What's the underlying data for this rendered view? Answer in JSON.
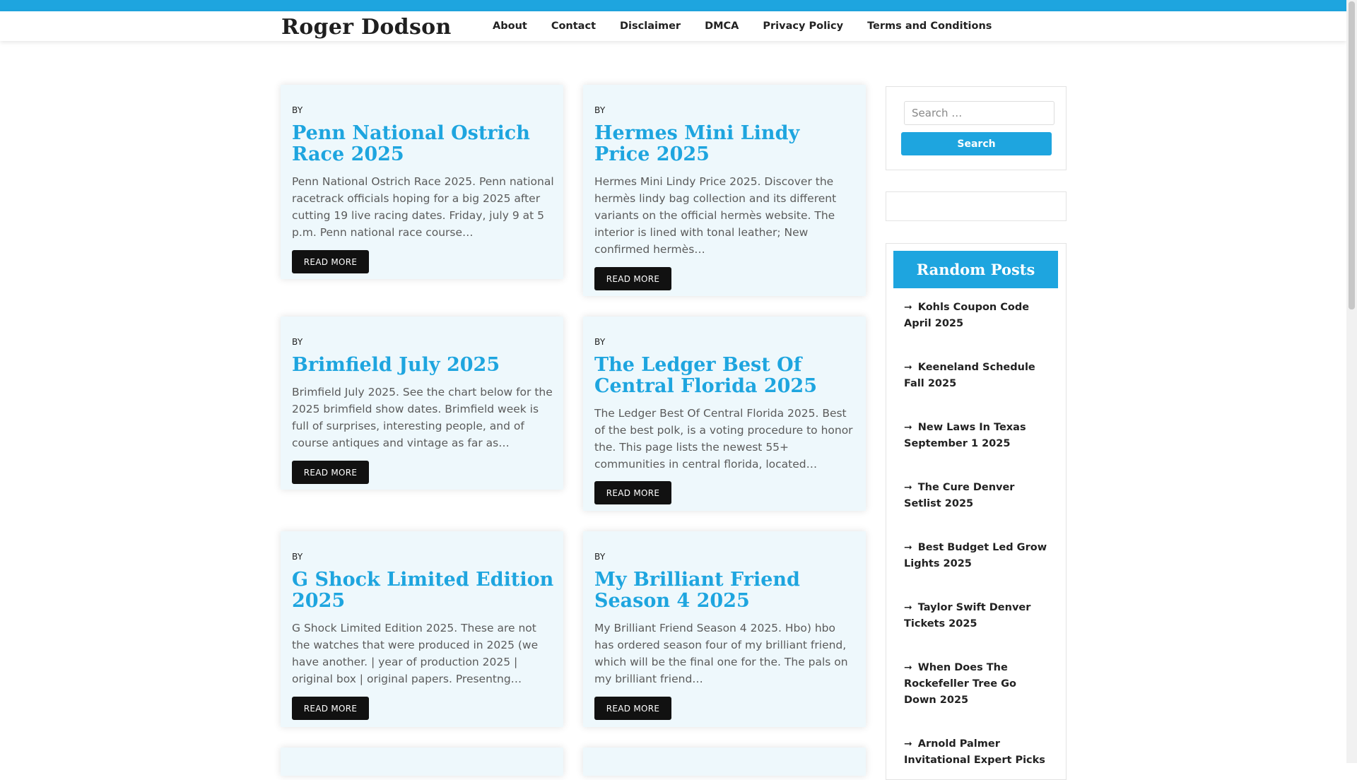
{
  "site": {
    "title": "Roger Dodson"
  },
  "nav": [
    "About",
    "Contact",
    "Disclaimer",
    "DMCA",
    "Privacy Policy",
    "Terms and Conditions"
  ],
  "posts": [
    {
      "by": "BY",
      "title": "Penn National Ostrich Race 2025",
      "excerpt": "Penn National Ostrich Race 2025. Penn national racetrack officials hoping for a big 2025 after cutting 19 live racing dates. Friday, july 9 at 5 p.m. Penn national race course…",
      "read_more": "READ MORE"
    },
    {
      "by": "BY",
      "title": "Hermes Mini Lindy Price 2025",
      "excerpt": "Hermes Mini Lindy Price 2025. Discover the hermès lindy bag collection and its different variants on the official hermès website. The interior is lined with tonal leather; New confirmed hermès…",
      "read_more": "READ MORE"
    },
    {
      "by": "BY",
      "title": "Brimfield July 2025",
      "excerpt": "Brimfield July 2025. See the chart below for the 2025 brimfield show dates. Brimfield week is full of surprises, interesting people, and of course antiques and vintage as far as…",
      "read_more": "READ MORE"
    },
    {
      "by": "BY",
      "title": "The Ledger Best Of Central Florida 2025",
      "excerpt": "The Ledger Best Of Central Florida 2025. Best of the best polk, is a voting procedure to honor the. This page lists the newest 55+ communities in central florida, located…",
      "read_more": "READ MORE"
    },
    {
      "by": "BY",
      "title": "G Shock Limited Edition 2025",
      "excerpt": "G Shock Limited Edition 2025. These are not the watches that were produced in 2025 (we have another. | year of production 2025 | original box | original papers. Presentng…",
      "read_more": "READ MORE"
    },
    {
      "by": "BY",
      "title": "My Brilliant Friend Season 4 2025",
      "excerpt": "My Brilliant Friend Season 4 2025. Hbo) hbo has ordered season four of my brilliant friend, which will be the final one for the. The pals on my brilliant friend…",
      "read_more": "READ MORE"
    }
  ],
  "search": {
    "placeholder": "Search …",
    "button_label": "Search"
  },
  "random_posts": {
    "heading": "Random Posts",
    "items": [
      "Kohls Coupon Code April 2025",
      "Keeneland Schedule Fall 2025",
      "New Laws In Texas September 1 2025",
      "The Cure Denver Setlist 2025",
      "Best Budget Led Grow Lights 2025",
      "Taylor Swift Denver Tickets 2025",
      "When Does The Rockefeller Tree Go Down 2025",
      "Arnold Palmer Invitational Expert Picks"
    ]
  },
  "icons": {
    "random_post_bullet": "arrow-right-icon"
  },
  "colors": {
    "accent": "#1ea5df",
    "card_bg": "#eef8fc",
    "button_dark": "#111111"
  }
}
